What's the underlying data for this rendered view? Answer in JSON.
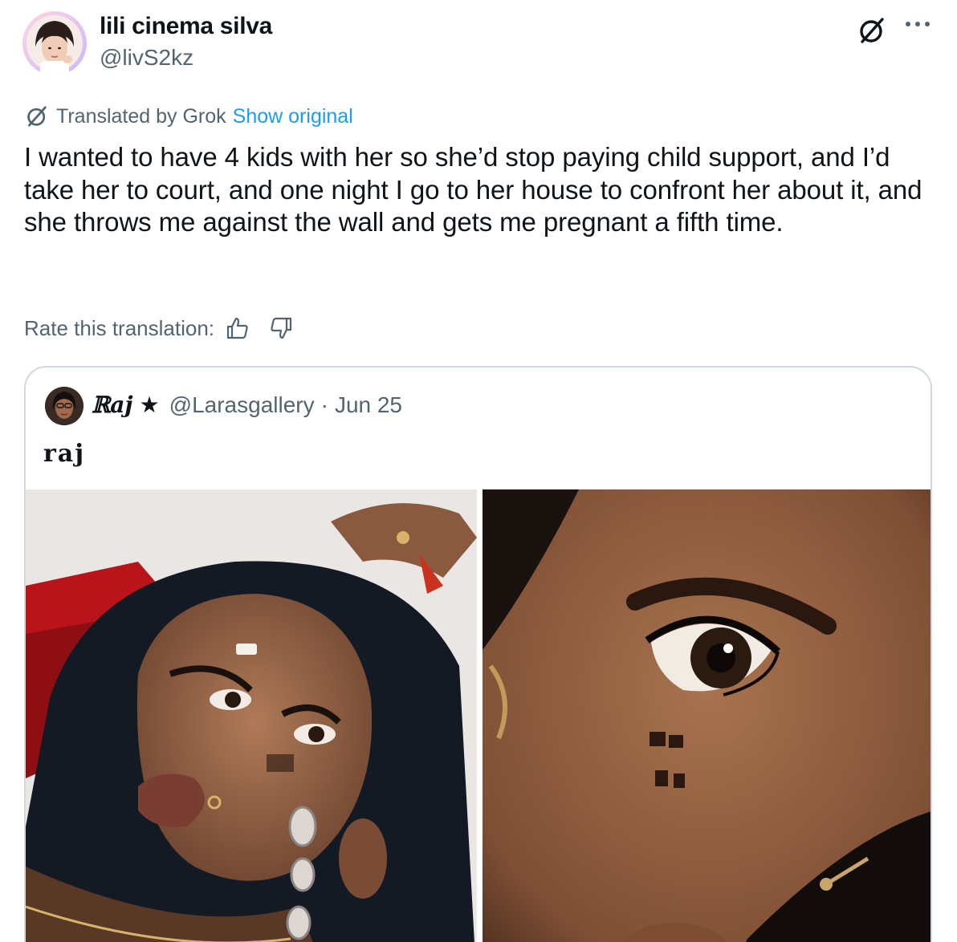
{
  "author": {
    "display_name": "lili cinema silva",
    "handle": "@livS2kz"
  },
  "translation": {
    "label": "Translated by Grok",
    "show_original": "Show original",
    "rate_label": "Rate this translation:"
  },
  "tweet": {
    "text": "I wanted to have 4 kids with her so she’d stop paying child support, and I’d take her to court, and one night I go to her house to confront her about it, and she throws me against the wall and gets me pregnant a fifth time."
  },
  "quoted": {
    "name": "ℝaj",
    "star": "★",
    "handle": "@Larasgallery",
    "separator": "·",
    "date": "Jun 25",
    "text": "raj",
    "photos": [
      "photo-portrait",
      "photo-closeup"
    ]
  },
  "icons": {
    "grok": "grok-icon",
    "more": "more-icon",
    "thumbs_up": "thumbs-up-icon",
    "thumbs_down": "thumbs-down-icon"
  },
  "colors": {
    "text": "#0f1419",
    "secondary": "#536471",
    "link": "#1d9bf0",
    "border": "#cfd9de"
  }
}
